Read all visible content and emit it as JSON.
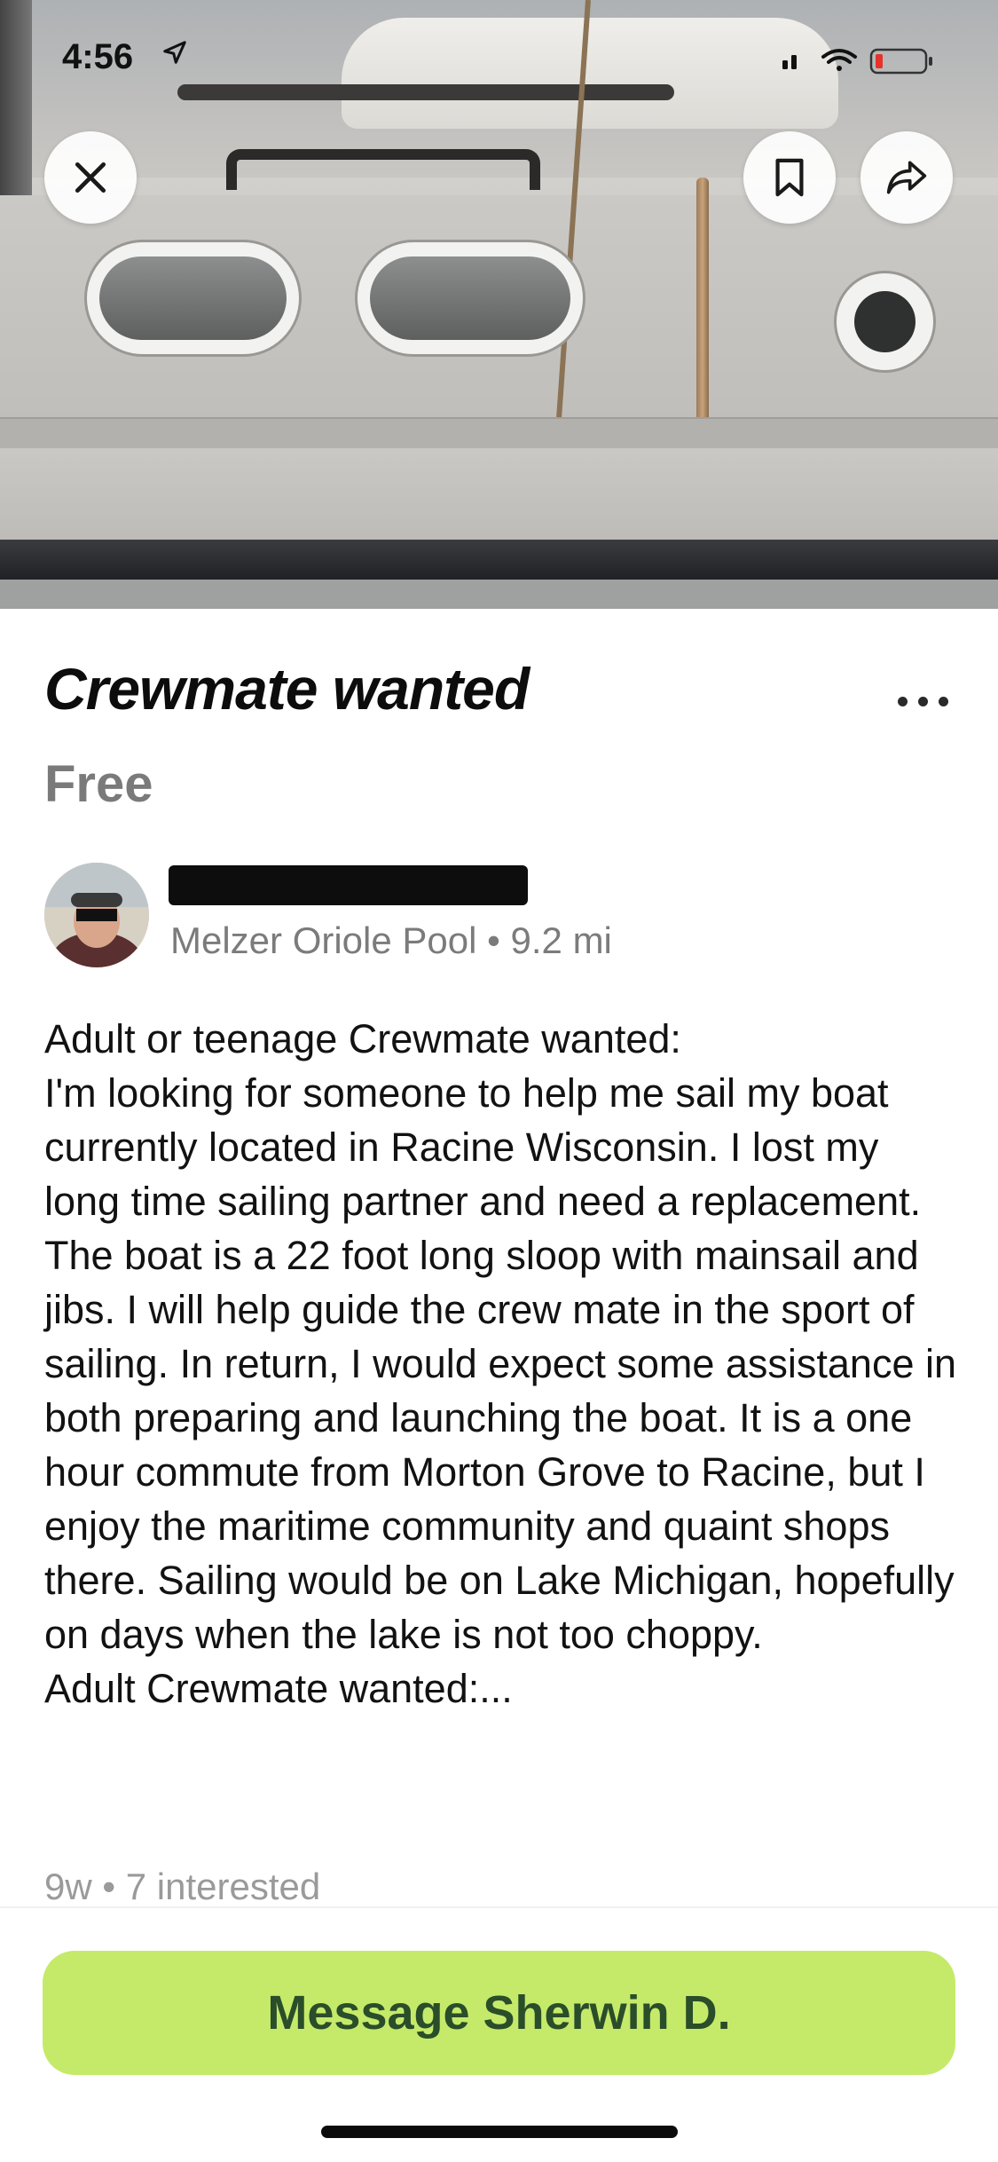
{
  "status_bar": {
    "time": "4:56"
  },
  "listing": {
    "title": "Crewmate wanted",
    "price": "Free",
    "seller": {
      "location": "Melzer Oriole Pool",
      "distance": "9.2 mi"
    },
    "description": "Adult or teenage Crewmate wanted:\nI'm looking for someone to help me sail my boat currently located in Racine Wisconsin. I lost my long time sailing partner and need a replacement. The boat is a 22 foot long sloop with mainsail and jibs. I will help guide the crew mate in the sport of sailing. In return, I would expect some assistance in both preparing and launching the boat. It is a one hour commute from Morton Grove to Racine, but I enjoy the maritime community and quaint shops there. Sailing would be on Lake Michigan, hopefully on days when the lake is not too choppy.\nAdult Crewmate wanted:...",
    "posted": "9w",
    "interested": "7 interested"
  },
  "actions": {
    "message_label": "Message Sherwin D."
  },
  "colors": {
    "cta_background": "#c5ea6a",
    "cta_text": "#2a4d2a",
    "muted_text": "#7b7b7b"
  },
  "icons": {
    "close": "close-icon",
    "bookmark": "bookmark-icon",
    "share": "share-icon",
    "more": "more-options-icon",
    "location_arrow": "location-arrow-icon"
  }
}
